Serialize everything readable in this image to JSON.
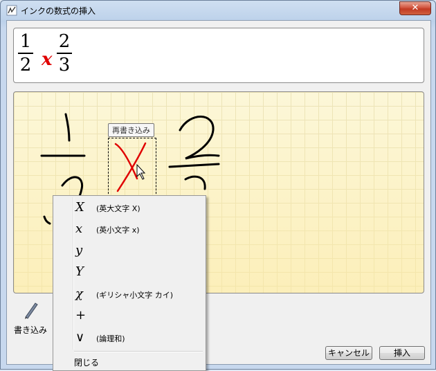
{
  "window": {
    "title": "インクの数式の挿入",
    "close_glyph": "✕"
  },
  "preview": {
    "fraction1": {
      "num": "1",
      "den": "2"
    },
    "variable": "x",
    "fraction2": {
      "num": "2",
      "den": "3"
    },
    "variable_color": "#e00000"
  },
  "ink_pad": {
    "tooltip": "再書き込み",
    "grid_color": "#ece4b8"
  },
  "tools": {
    "write_label": "書き込み",
    "write_icon": "pen-icon"
  },
  "buttons": {
    "cancel": "キャンセル",
    "insert": "挿入"
  },
  "context_menu": {
    "items": [
      {
        "symbol": "X",
        "desc": "(英大文字 X)"
      },
      {
        "symbol": "x",
        "desc": "(英小文字 x)"
      },
      {
        "symbol": "y",
        "desc": ""
      },
      {
        "symbol": "Y",
        "desc": ""
      },
      {
        "symbol": "χ",
        "desc": "(ギリシャ小文字 カイ)"
      },
      {
        "symbol": "+",
        "desc": ""
      },
      {
        "symbol": "∨",
        "desc": "(論理和)"
      }
    ],
    "close": "閉じる"
  }
}
